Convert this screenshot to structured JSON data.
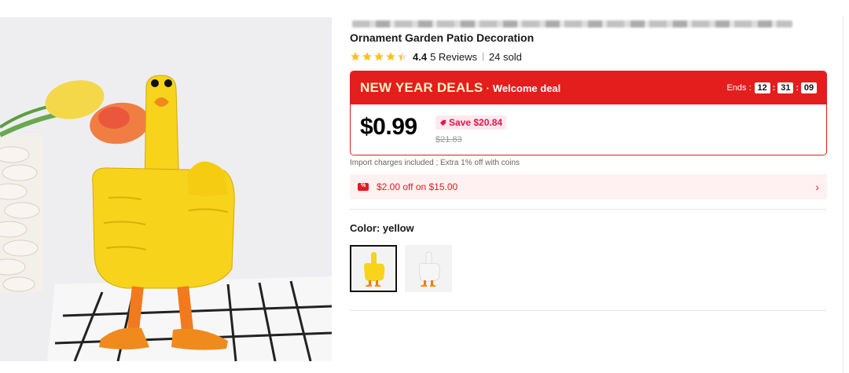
{
  "product": {
    "title": "Ornament Garden Patio Decoration",
    "rating": "4.4",
    "reviews": "5 Reviews",
    "sold": "24 sold",
    "stars_filled": 4.4
  },
  "deal": {
    "name": "NEW YEAR DEALS",
    "separator": "·",
    "subtitle": "Welcome deal",
    "ends_label": "Ends :",
    "hours": "12",
    "minutes": "31",
    "seconds": "09",
    "price": "$0.99",
    "save": "Save $20.84",
    "original_price": "$21.83"
  },
  "import_note": "Import charges included ; Extra 1% off with coins",
  "coupon": {
    "text": "$2.00 off on $15.00",
    "chevron": "›"
  },
  "color": {
    "label": "Color: yellow",
    "options": [
      "yellow",
      "white"
    ],
    "selected": "yellow"
  },
  "colors": {
    "accent_red": "#e41d1d",
    "save_pink": "#e4134b",
    "coupon_bg": "#fff1f1",
    "star_gold": "#ffbf1f"
  }
}
